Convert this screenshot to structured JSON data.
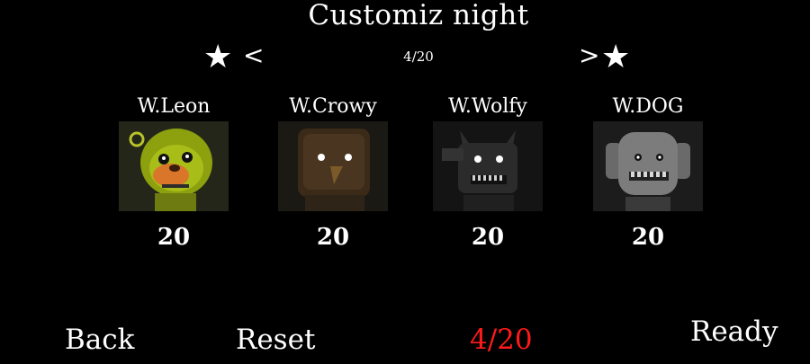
{
  "title": "Customiz night",
  "nav": {
    "prev_arrow": "<",
    "next_arrow": ">",
    "star": "★",
    "page_indicator": "4/20"
  },
  "characters": [
    {
      "name": "W.Leon",
      "level": "20",
      "icon": "yellow-animatronic-portrait"
    },
    {
      "name": "W.Crowy",
      "level": "20",
      "icon": "brown-bird-animatronic-portrait"
    },
    {
      "name": "W.Wolfy",
      "level": "20",
      "icon": "dark-wolf-animatronic-portrait"
    },
    {
      "name": "W.DOG",
      "level": "20",
      "icon": "gray-dog-animatronic-portrait"
    }
  ],
  "bottom": {
    "back_label": "Back",
    "reset_label": "Reset",
    "counter": "4/20",
    "ready_label": "Ready"
  },
  "colors": {
    "background": "#000000",
    "text": "#ffffff",
    "counter": "#ff1a1a"
  }
}
